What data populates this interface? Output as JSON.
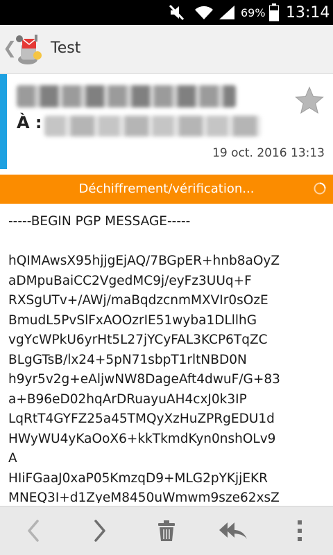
{
  "status_bar": {
    "battery_percent": "69%",
    "time": "13:14",
    "icons": [
      "mute-icon",
      "wifi-icon",
      "signal-icon",
      "battery-icon"
    ]
  },
  "action_bar": {
    "title": "Test",
    "icons": [
      "back-icon",
      "app-icon"
    ]
  },
  "header": {
    "to_label": "À :",
    "date": "19 oct. 2016 13:13",
    "accent_color": "#1ea1e1",
    "icons": [
      "star-icon"
    ]
  },
  "decrypt_bar": {
    "label": "Déchiffrement/vérification...",
    "color": "#fb8c00",
    "icons": [
      "spinner-icon"
    ]
  },
  "message": {
    "begin": "-----BEGIN PGP MESSAGE-----",
    "lines": [
      "hQIMAwsX95hjjgEjAQ/7BGpER+hnb8aOyZ",
      "aDMpuBaiCC2VgedMC9j/eyFz3UUq+F",
      "RXSgUTv+/AWj/maBqdzcnmMXVIr0sOzE",
      "BmudL5PvSlFxAOOzrIE51wyba1DLllhG",
      "vgYcWPkU6yrHt5L27jYCyFAL3KCP6TqZC",
      "BLgGTsB/lx24+5pN71sbpT1rltNBD0N",
      "h9yr5v2g+eAljwNW8DageAft4dwuF/G+83",
      "a+B96eD02hqArDRuayuAH4cxJ0k3IP",
      "LqRtT4GYFZ25a45TMQyXzHuZPRgEDU1d",
      "HWyWU4yKaOoX6+kkTkmdKyn0nshOLv9",
      "A",
      "HIiFGaaJ0xaP05KmzqD9+MLG2pYKjjEKR",
      "MNEQ3I+d1ZyeM8450uWmwm9sze62xsZ"
    ]
  },
  "toolbar": {
    "icons": [
      "previous-icon",
      "next-icon",
      "delete-icon",
      "reply-all-icon",
      "overflow-menu-icon"
    ]
  }
}
